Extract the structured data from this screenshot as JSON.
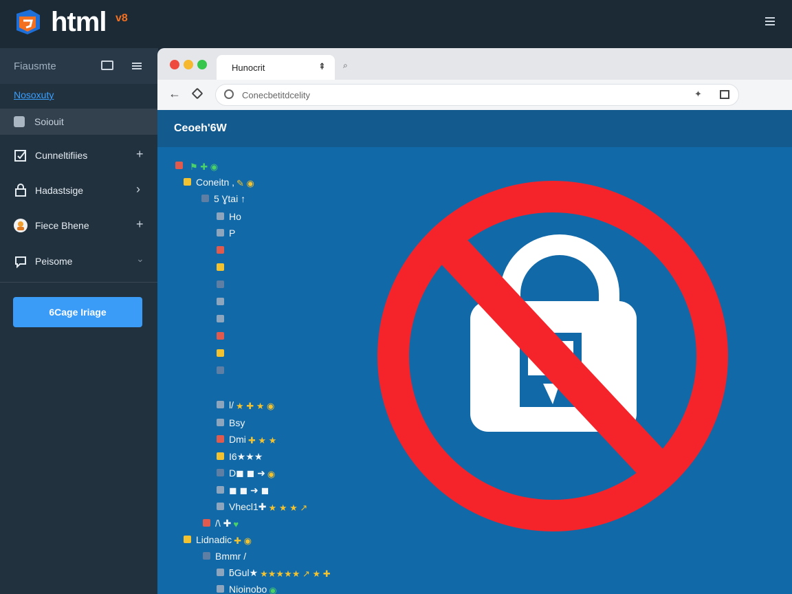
{
  "app": {
    "brand": "html",
    "brand_badge": "v8"
  },
  "sidebar": {
    "title": "Fiausmte",
    "link": "Nosoxuty",
    "active_item": "Soiouit",
    "items": [
      {
        "label": "Cunneltifiies",
        "icon": "checkbox-icon",
        "action": "+"
      },
      {
        "label": "Hadastsige",
        "icon": "lock-icon",
        "action": "›"
      },
      {
        "label": "Fiece Bhene",
        "icon": "avatar-icon",
        "action": "+"
      },
      {
        "label": "Peisome",
        "icon": "chat-icon",
        "action": "⌄"
      }
    ],
    "button": "6Cage Iriage"
  },
  "browser": {
    "tab_title": "Hunocrit",
    "tab_pin": "⇞",
    "new_tab": "⌕",
    "url_text": "Conecbetitdcelity",
    "url_star": "✦",
    "page_title": "Ceoeh'6W"
  },
  "tree": [
    {
      "text": "",
      "emoji": "⚑ ✚ ◉"
    },
    {
      "text": "Coneitn ,",
      "emoji": "✎ ◉"
    },
    {
      "text": "5 Ɣtai ↑",
      "emoji": ""
    },
    {
      "text": "Ho",
      "emoji": ""
    },
    {
      "text": "P",
      "emoji": ""
    },
    {
      "text": "",
      "emoji": ""
    },
    {
      "text": "",
      "emoji": ""
    },
    {
      "text": "",
      "emoji": ""
    },
    {
      "text": "",
      "emoji": ""
    },
    {
      "text": "",
      "emoji": ""
    },
    {
      "text": "",
      "emoji": ""
    },
    {
      "text": "",
      "emoji": ""
    },
    {
      "text": "",
      "emoji": ""
    },
    {
      "text": "l/",
      "emoji": "★ ✚ ★ ◉"
    },
    {
      "text": "Bsy",
      "emoji": ""
    },
    {
      "text": "Dmi",
      "emoji": "✚ ★ ★"
    },
    {
      "text": "I6★★★",
      "emoji": ""
    },
    {
      "text": "D◼ ◼ ➜",
      "emoji": "◉"
    },
    {
      "text": "◼ ◼ ➜ ◼",
      "emoji": ""
    },
    {
      "text": "Vhecl1✚",
      "emoji": "★ ★ ★ ↗"
    },
    {
      "text": "/\\ ✚",
      "emoji": "♥"
    },
    {
      "text": "Lidnadic",
      "emoji": "✚ ◉"
    },
    {
      "text": "Bmmr /",
      "emoji": ""
    },
    {
      "text": "ƃGul★",
      "emoji": "★★★★★ ↗ ★ ✚"
    },
    {
      "text": "Nioinobo",
      "emoji": "◉"
    }
  ],
  "overlay": {
    "icon": "blocked-lock-icon",
    "ring_color": "#f5242a",
    "lock_color": "#ffffff"
  }
}
